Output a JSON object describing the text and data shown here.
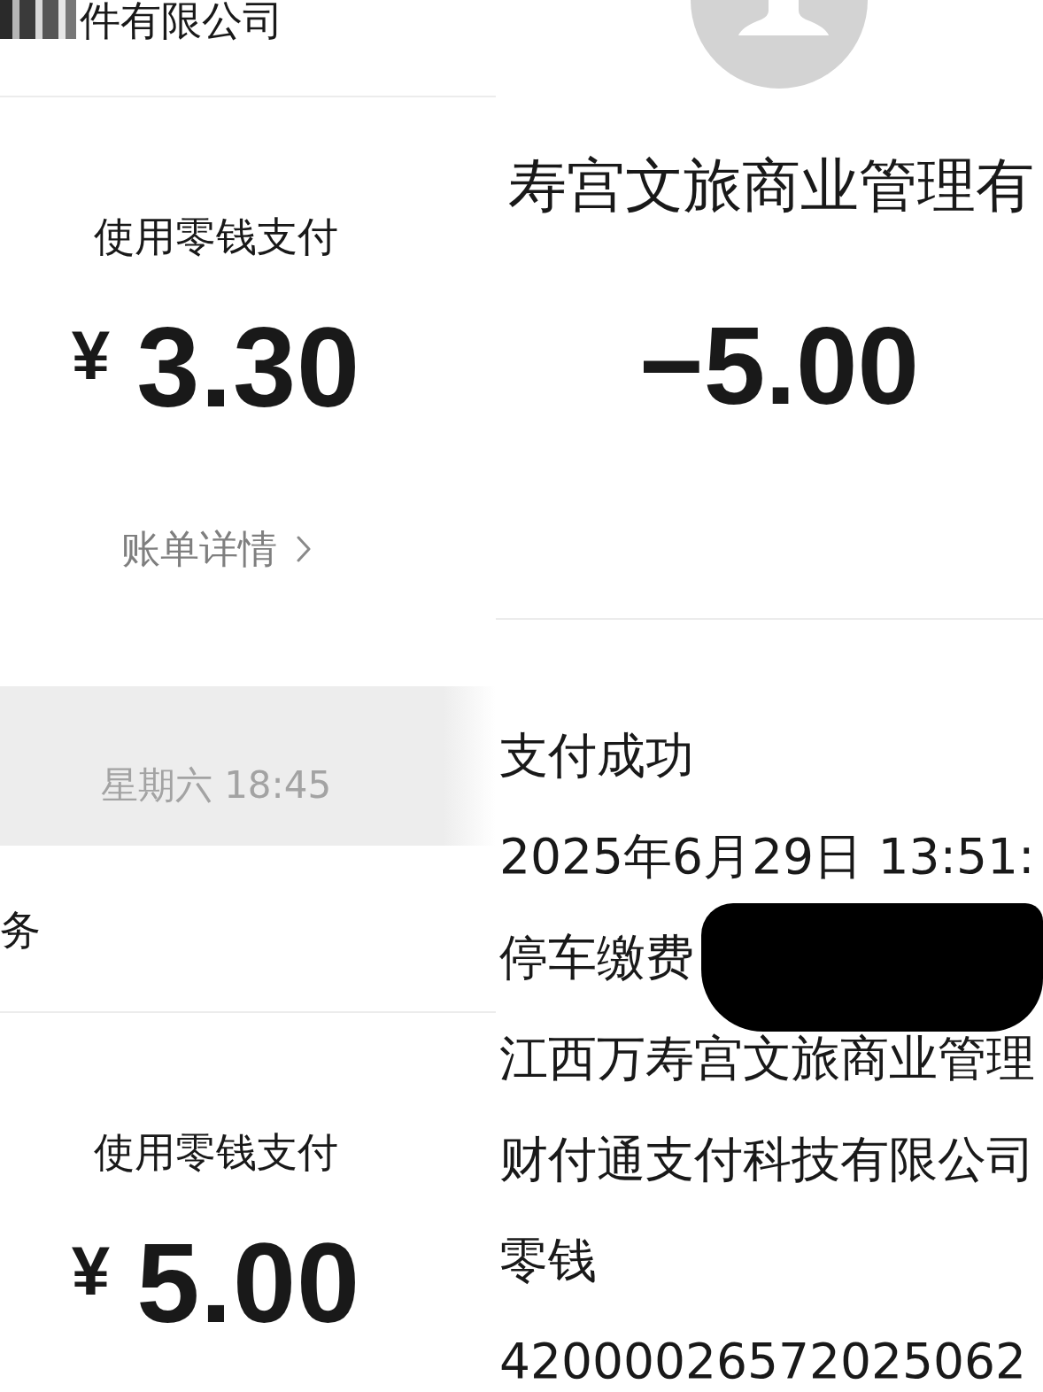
{
  "left_panel": {
    "header": {
      "text": "件有限公司",
      "redacted": true
    },
    "items": [
      {
        "kind": "payment",
        "title": "使用零钱支付",
        "currency": "¥",
        "amount": "3.30",
        "link": "账单详情"
      },
      {
        "kind": "timestamp",
        "text": "星期六 18:45"
      },
      {
        "kind": "message",
        "text": "务"
      },
      {
        "kind": "payment",
        "title": "使用零钱支付",
        "currency": "¥",
        "amount": "5.00"
      }
    ]
  },
  "right_panel": {
    "merchant": "寿宫文旅商业管理有",
    "amount": "−5.00",
    "details": [
      {
        "text": "支付成功",
        "redacted": false
      },
      {
        "text": "2025年6月29日 13:51:",
        "redacted": false
      },
      {
        "text": "停车缴费",
        "redacted": true
      },
      {
        "text": "江西万寿宫文旅商业管理",
        "redacted": false
      },
      {
        "text": "财付通支付科技有限公司",
        "redacted": false
      },
      {
        "text": "零钱",
        "redacted": false
      },
      {
        "text": "42000026572025062",
        "redacted": false
      }
    ]
  }
}
